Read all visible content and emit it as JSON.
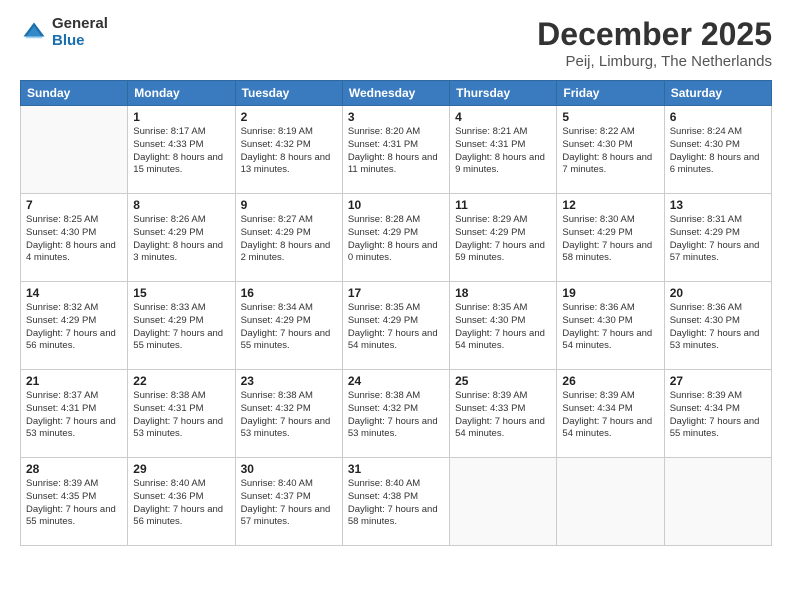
{
  "logo": {
    "general": "General",
    "blue": "Blue"
  },
  "title": "December 2025",
  "subtitle": "Peij, Limburg, The Netherlands",
  "days_header": [
    "Sunday",
    "Monday",
    "Tuesday",
    "Wednesday",
    "Thursday",
    "Friday",
    "Saturday"
  ],
  "weeks": [
    [
      {
        "num": "",
        "sunrise": "",
        "sunset": "",
        "daylight": ""
      },
      {
        "num": "1",
        "sunrise": "Sunrise: 8:17 AM",
        "sunset": "Sunset: 4:33 PM",
        "daylight": "Daylight: 8 hours and 15 minutes."
      },
      {
        "num": "2",
        "sunrise": "Sunrise: 8:19 AM",
        "sunset": "Sunset: 4:32 PM",
        "daylight": "Daylight: 8 hours and 13 minutes."
      },
      {
        "num": "3",
        "sunrise": "Sunrise: 8:20 AM",
        "sunset": "Sunset: 4:31 PM",
        "daylight": "Daylight: 8 hours and 11 minutes."
      },
      {
        "num": "4",
        "sunrise": "Sunrise: 8:21 AM",
        "sunset": "Sunset: 4:31 PM",
        "daylight": "Daylight: 8 hours and 9 minutes."
      },
      {
        "num": "5",
        "sunrise": "Sunrise: 8:22 AM",
        "sunset": "Sunset: 4:30 PM",
        "daylight": "Daylight: 8 hours and 7 minutes."
      },
      {
        "num": "6",
        "sunrise": "Sunrise: 8:24 AM",
        "sunset": "Sunset: 4:30 PM",
        "daylight": "Daylight: 8 hours and 6 minutes."
      }
    ],
    [
      {
        "num": "7",
        "sunrise": "Sunrise: 8:25 AM",
        "sunset": "Sunset: 4:30 PM",
        "daylight": "Daylight: 8 hours and 4 minutes."
      },
      {
        "num": "8",
        "sunrise": "Sunrise: 8:26 AM",
        "sunset": "Sunset: 4:29 PM",
        "daylight": "Daylight: 8 hours and 3 minutes."
      },
      {
        "num": "9",
        "sunrise": "Sunrise: 8:27 AM",
        "sunset": "Sunset: 4:29 PM",
        "daylight": "Daylight: 8 hours and 2 minutes."
      },
      {
        "num": "10",
        "sunrise": "Sunrise: 8:28 AM",
        "sunset": "Sunset: 4:29 PM",
        "daylight": "Daylight: 8 hours and 0 minutes."
      },
      {
        "num": "11",
        "sunrise": "Sunrise: 8:29 AM",
        "sunset": "Sunset: 4:29 PM",
        "daylight": "Daylight: 7 hours and 59 minutes."
      },
      {
        "num": "12",
        "sunrise": "Sunrise: 8:30 AM",
        "sunset": "Sunset: 4:29 PM",
        "daylight": "Daylight: 7 hours and 58 minutes."
      },
      {
        "num": "13",
        "sunrise": "Sunrise: 8:31 AM",
        "sunset": "Sunset: 4:29 PM",
        "daylight": "Daylight: 7 hours and 57 minutes."
      }
    ],
    [
      {
        "num": "14",
        "sunrise": "Sunrise: 8:32 AM",
        "sunset": "Sunset: 4:29 PM",
        "daylight": "Daylight: 7 hours and 56 minutes."
      },
      {
        "num": "15",
        "sunrise": "Sunrise: 8:33 AM",
        "sunset": "Sunset: 4:29 PM",
        "daylight": "Daylight: 7 hours and 55 minutes."
      },
      {
        "num": "16",
        "sunrise": "Sunrise: 8:34 AM",
        "sunset": "Sunset: 4:29 PM",
        "daylight": "Daylight: 7 hours and 55 minutes."
      },
      {
        "num": "17",
        "sunrise": "Sunrise: 8:35 AM",
        "sunset": "Sunset: 4:29 PM",
        "daylight": "Daylight: 7 hours and 54 minutes."
      },
      {
        "num": "18",
        "sunrise": "Sunrise: 8:35 AM",
        "sunset": "Sunset: 4:30 PM",
        "daylight": "Daylight: 7 hours and 54 minutes."
      },
      {
        "num": "19",
        "sunrise": "Sunrise: 8:36 AM",
        "sunset": "Sunset: 4:30 PM",
        "daylight": "Daylight: 7 hours and 54 minutes."
      },
      {
        "num": "20",
        "sunrise": "Sunrise: 8:36 AM",
        "sunset": "Sunset: 4:30 PM",
        "daylight": "Daylight: 7 hours and 53 minutes."
      }
    ],
    [
      {
        "num": "21",
        "sunrise": "Sunrise: 8:37 AM",
        "sunset": "Sunset: 4:31 PM",
        "daylight": "Daylight: 7 hours and 53 minutes."
      },
      {
        "num": "22",
        "sunrise": "Sunrise: 8:38 AM",
        "sunset": "Sunset: 4:31 PM",
        "daylight": "Daylight: 7 hours and 53 minutes."
      },
      {
        "num": "23",
        "sunrise": "Sunrise: 8:38 AM",
        "sunset": "Sunset: 4:32 PM",
        "daylight": "Daylight: 7 hours and 53 minutes."
      },
      {
        "num": "24",
        "sunrise": "Sunrise: 8:38 AM",
        "sunset": "Sunset: 4:32 PM",
        "daylight": "Daylight: 7 hours and 53 minutes."
      },
      {
        "num": "25",
        "sunrise": "Sunrise: 8:39 AM",
        "sunset": "Sunset: 4:33 PM",
        "daylight": "Daylight: 7 hours and 54 minutes."
      },
      {
        "num": "26",
        "sunrise": "Sunrise: 8:39 AM",
        "sunset": "Sunset: 4:34 PM",
        "daylight": "Daylight: 7 hours and 54 minutes."
      },
      {
        "num": "27",
        "sunrise": "Sunrise: 8:39 AM",
        "sunset": "Sunset: 4:34 PM",
        "daylight": "Daylight: 7 hours and 55 minutes."
      }
    ],
    [
      {
        "num": "28",
        "sunrise": "Sunrise: 8:39 AM",
        "sunset": "Sunset: 4:35 PM",
        "daylight": "Daylight: 7 hours and 55 minutes."
      },
      {
        "num": "29",
        "sunrise": "Sunrise: 8:40 AM",
        "sunset": "Sunset: 4:36 PM",
        "daylight": "Daylight: 7 hours and 56 minutes."
      },
      {
        "num": "30",
        "sunrise": "Sunrise: 8:40 AM",
        "sunset": "Sunset: 4:37 PM",
        "daylight": "Daylight: 7 hours and 57 minutes."
      },
      {
        "num": "31",
        "sunrise": "Sunrise: 8:40 AM",
        "sunset": "Sunset: 4:38 PM",
        "daylight": "Daylight: 7 hours and 58 minutes."
      },
      {
        "num": "",
        "sunrise": "",
        "sunset": "",
        "daylight": ""
      },
      {
        "num": "",
        "sunrise": "",
        "sunset": "",
        "daylight": ""
      },
      {
        "num": "",
        "sunrise": "",
        "sunset": "",
        "daylight": ""
      }
    ]
  ]
}
